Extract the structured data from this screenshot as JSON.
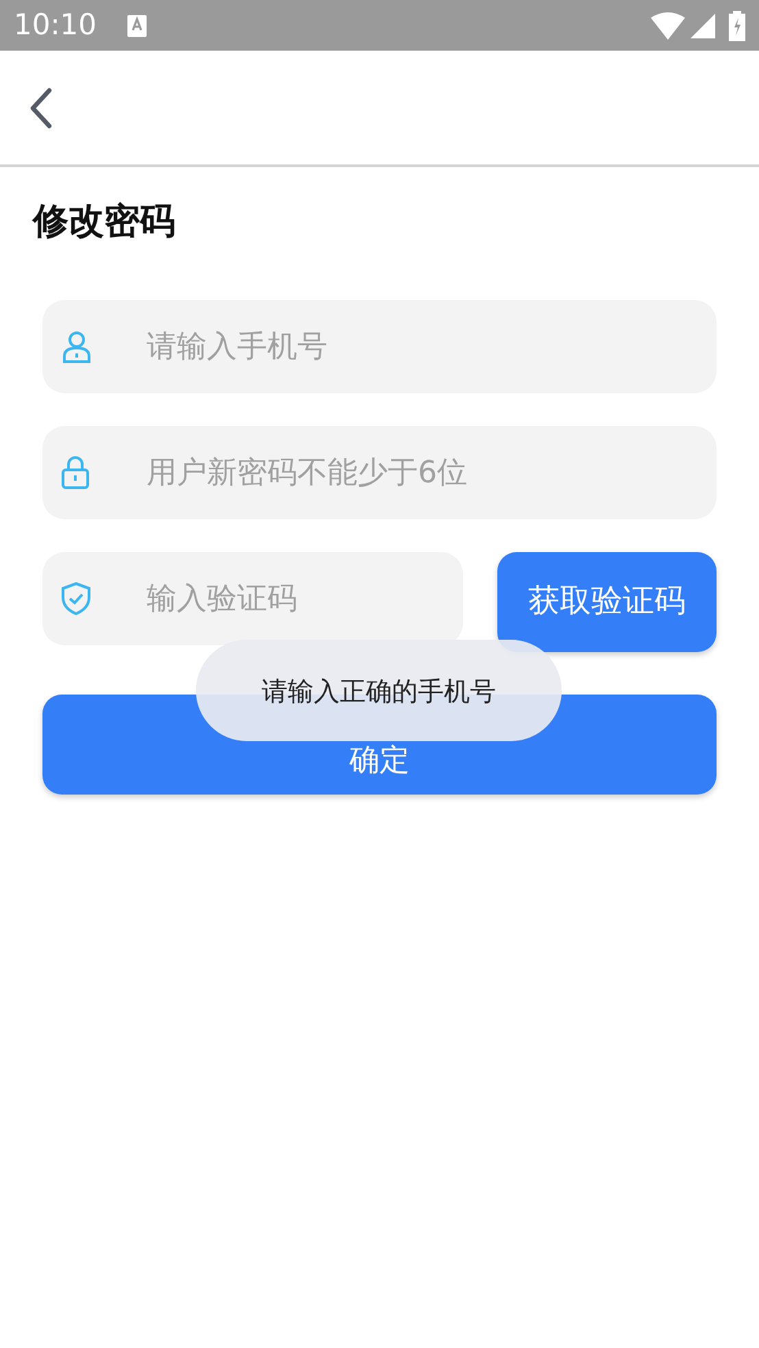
{
  "status_bar": {
    "time": "10:10"
  },
  "page": {
    "title": "修改密码"
  },
  "fields": [
    {
      "kind": "phone",
      "placeholder": "请输入手机号"
    },
    {
      "kind": "password",
      "placeholder": "用户新密码不能少于6位"
    },
    {
      "kind": "code",
      "placeholder": "输入验证码"
    }
  ],
  "get_code_button": "获取验证码",
  "confirm_button": "确定",
  "toast": "请输入正确的手机号"
}
